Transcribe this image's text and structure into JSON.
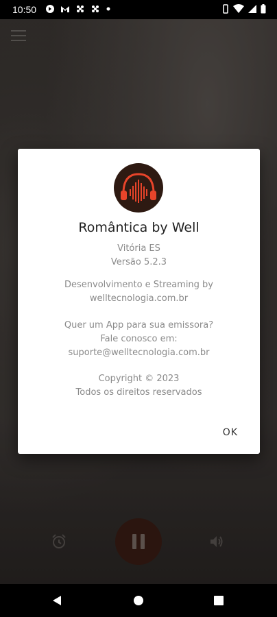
{
  "status_bar": {
    "time": "10:50",
    "left_icons": [
      "app-icon-1",
      "app-icon-2",
      "app-icon-3",
      "app-icon-4",
      "dot"
    ],
    "right_icons": [
      "vibrate-icon",
      "wifi-icon",
      "signal-icon",
      "battery-icon"
    ]
  },
  "dialog": {
    "title": "Romântica by Well",
    "location": "Vitória ES",
    "version": "Versão 5.2.3",
    "dev_line_1": "Desenvolvimento e Streaming by",
    "dev_line_2": "welltecnologia.com.br",
    "promo_line_1": "Quer um App para sua emissora?",
    "promo_line_2": "Fale conosco em:",
    "promo_line_3": "suporte@welltecnologia.com.br",
    "copyright_line_1": "Copyright © 2023",
    "copyright_line_2": "Todos os direitos reservados",
    "ok_label": "OK"
  },
  "colors": {
    "logo_accent": "#e8442a",
    "logo_bg": "#2e1a12",
    "play_button_bg": "#3a1d14"
  }
}
